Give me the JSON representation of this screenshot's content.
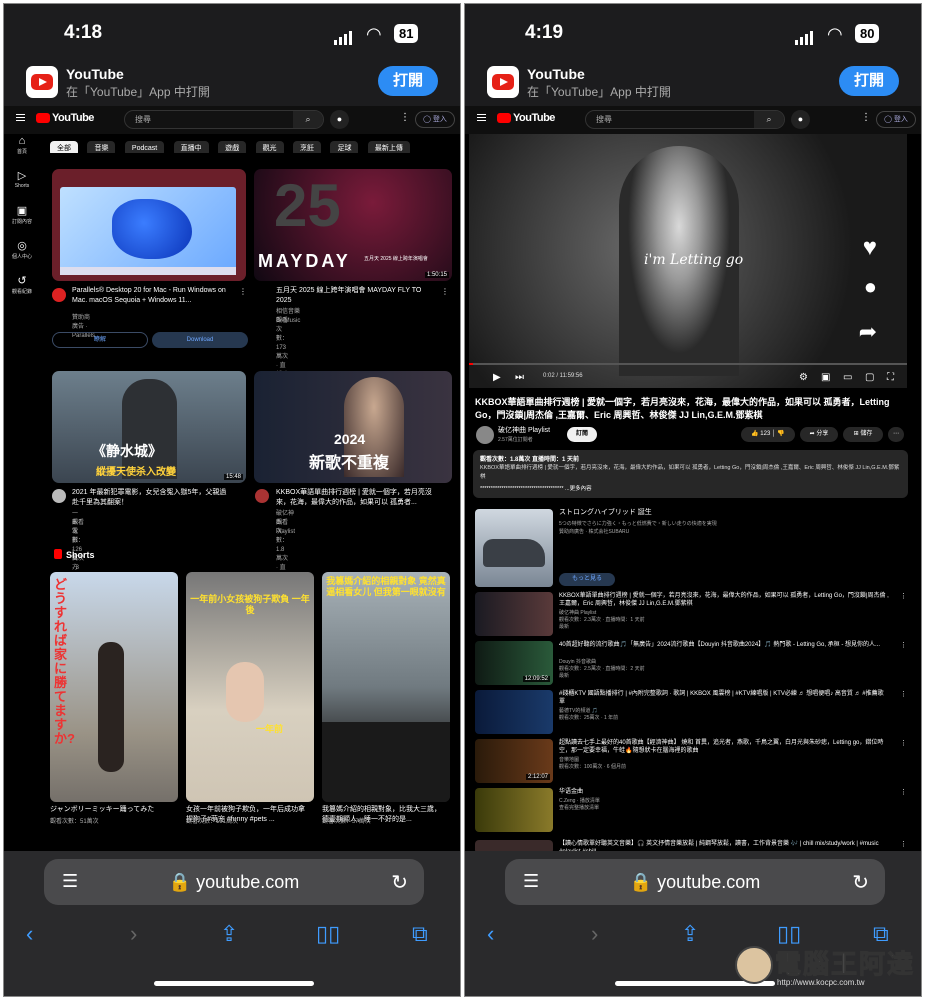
{
  "left": {
    "status": {
      "time": "4:18",
      "battery": "81"
    },
    "banner": {
      "app_name": "YouTube",
      "subtitle": "在「YouTube」App 中打開",
      "open_label": "打開"
    },
    "header": {
      "search_placeholder": "搜尋",
      "signin_label": "登入"
    },
    "nav": [
      {
        "icon": "⌂",
        "label": "首頁"
      },
      {
        "icon": "▷",
        "label": "Shorts"
      },
      {
        "icon": "▣",
        "label": "訂閱內容"
      },
      {
        "icon": "◎",
        "label": "個人中心"
      },
      {
        "icon": "↺",
        "label": "觀看紀錄"
      }
    ],
    "chips": [
      "全部",
      "音樂",
      "Podcast",
      "直播中",
      "遊戲",
      "觀光",
      "烹飪",
      "足球",
      "最新上傳"
    ],
    "cards": [
      {
        "title": "Parallels® Desktop 20 for Mac - Run Windows on Mac. macOS Sequoia + Windows 11...",
        "sub1": "贊助商廣告 · Parallels",
        "sub2": ""
      },
      {
        "title": "五月天 2025 線上跨年演唱會 MAYDAY FLY TO 2025",
        "sub1": "相信音樂BinMusic",
        "sub2": "觀看次數：173萬次 · 直播時間：15 小時前",
        "duration": "1:50:15"
      },
      {
        "title": "2021 年最新犯罪電影，女兒含冤入獄5年，父親過赴千里為其翻案！",
        "sub1": "一米電影·官方頻道",
        "sub2": "觀看次數：126萬次 · 3 年前",
        "duration": "15:48"
      },
      {
        "title": "KKBOX華語單曲排行週榜 | 愛就一個字，若月亮沒來，花海，最偉大的作品，如果可以 孤勇者...",
        "sub1": "破亿神曲 Playlist",
        "sub2": "觀看次數：1.8萬次 · 直播時間：15 小時前"
      }
    ],
    "card1_buttons": {
      "learn": "瞭解",
      "download": "Download"
    },
    "thumb_text": {
      "mayday": "MAYDAY",
      "mayday_sub": "五月天 2025 線上跨年演唱會",
      "movie": "《静水城》",
      "movie_sub": "縱擾天使杀入改變",
      "year": "2024",
      "song": "新歌不重複"
    },
    "shorts_label": "Shorts",
    "shorts": [
      {
        "title": "ジャンボリーミッキー踊ってみた",
        "views": "觀看次數：51萬次",
        "overlay": "どうすれば家に 勝てますか?"
      },
      {
        "title": "女孩一年前被狗子欺负，一年后成功拿捏狗子#萌宠 #funny #pets ...",
        "views": "觀看次數：191萬次",
        "overlay": "一年前小女孩被狗子欺負 一年後",
        "tag": "一年前"
      },
      {
        "title": "我篡媽介紹的相親對象，比我大三歲，德壹期顯人，睡一不好的是...",
        "views": "觀看次數：57萬次",
        "overlay": "我篡媽介紹的相親對象 竟然真逼相看女儿 但我第一眼就沒有"
      }
    ],
    "safari": {
      "host": "youtube.com"
    }
  },
  "right": {
    "status": {
      "time": "4:19",
      "battery": "80"
    },
    "banner": {
      "app_name": "YouTube",
      "subtitle": "在「YouTube」App 中打開",
      "open_label": "打開"
    },
    "header": {
      "search_placeholder": "搜尋",
      "signin_label": "登入"
    },
    "player": {
      "caption": "i'm Letting go",
      "time": "0:02 / 11:59:56"
    },
    "video": {
      "title": "KKBOX華語單曲排行週榜 | 愛就一個字，若月亮沒來，花海，最偉大的作品，如果可以 孤勇者，Letting Go，門沒鎖|周杰倫 ,王嘉爾、Eric 周興哲、林俊傑 JJ Lin,G.E.M.鄧紫棋",
      "channel": "破亿神曲 Playlist",
      "subs": "2.57萬位訂閱者",
      "subscribe": "訂閱",
      "likes": "123",
      "share": "分享",
      "save": "儲存"
    },
    "description": {
      "stats": "觀看次數：1.8萬次 直播時間：1 天前",
      "text": "KKBOX華語單曲排行週榜 | 愛就一個字，若月亮沒來，花海，最偉大的作品，如果可以 孤勇者，Letting Go，門沒鎖|周杰倫 ,王嘉爾、Eric 周興哲、林俊傑 JJ Lin,G.E.M.鄧紫棋",
      "more": "*************************************** ...更多內容"
    },
    "ad": {
      "title": "ストロングハイブリッド 誕生",
      "line1": "5つの特徴でさらに力強く・もっと低燃費で・新しい走りの快適を実現",
      "line2": "贊助商廣告 · 株式会社SUBARU",
      "button": "もっと見る"
    },
    "list": [
      {
        "title": "KKBOX華語單曲排行週榜 | 愛就一個字，若月亮沒來，花海，最偉大的作品，如果可以 孤勇者，Letting Go，門沒鎖|周杰倫 ,王嘉爾，Eric 周興哲，林俊傑 JJ Lin,G.E.M.鄧紫棋",
        "sub1": "破亿神曲 Playlist",
        "sub2": "觀看次數：2.3萬次 · 直播時間：1 天前",
        "sub3": "最新"
      },
      {
        "title": "40首超好聽的流行歌曲🎵「無廣告」2024流行歌曲【Douyin 抖音歌曲2024】🎵 熱門歌 - Letting Go, 承桓 - 想見你的人...",
        "sub1": "Douyin 抖音歌曲",
        "sub2": "觀看次數：2.5萬次 · 直播時間：2 天前",
        "sub3": "最新",
        "duration": "12:09:52"
      },
      {
        "title": "#錢櫃KTV 國語點播排行 | #內附完整歌詞 · 歌詞 | KKBOX 風雲榜 | #KTV練唱版 | KTV必練 ♬ 想唱便唱♪ 高音質 ♬ #推薦歌單",
        "sub1": "藝德TV的頻道 🎵",
        "sub2": "觀看次數：25萬次 · 1 年前"
      },
      {
        "title": "超點讀去七手上最好的40首歌曲【經濟神曲】 燒和 首異，追光者，燕歌，千鳥之翼，白月光與朱砂痣，Letting go，錯位時空，那一定要幸福，牛蛙🔥隨想狀卡在腦海裡的歌曲",
        "sub1": "音樂地圖",
        "sub2": "觀看次數：100萬次 · 6 個月前",
        "duration": "2:12:07"
      },
      {
        "title": "华语金曲",
        "sub1": "C.Zeng · 播放清單",
        "sub2": "查看完整播放清單",
        "duration": ""
      },
      {
        "title": "【讀心情歌單好聽英文音樂】🎧 英文抒情音樂放鬆 | 純鋼琴放鬆，讀書，工作背景音樂 🎶 | chill mix/study/work | #music #playlist #chill",
        "sub1": "",
        "sub2": ""
      }
    ],
    "safari": {
      "host": "youtube.com"
    }
  },
  "watermark": {
    "text": "電腦王阿達",
    "url": "http://www.kocpc.com.tw"
  }
}
